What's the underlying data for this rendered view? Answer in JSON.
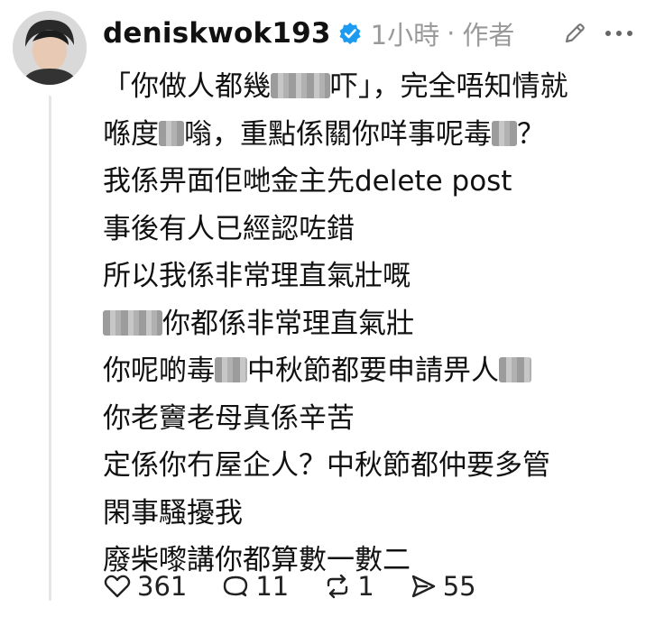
{
  "post": {
    "username": "deniskwok193",
    "time": "1小時",
    "separator": "·",
    "author_tag": "作者",
    "lines": [
      [
        "「你做人都幾",
        "[blur]",
        "吓」，完全唔知情就"
      ],
      [
        "喺度",
        "[blur]",
        "嗡，重點係關你咩事呢毒",
        "[blur]",
        "？"
      ],
      [
        "我係畀面佢哋金主先delete post"
      ],
      [
        "事後有人已經認咗錯"
      ],
      [
        "所以我係非常理直氣壯嘅"
      ],
      [
        "[blur]",
        "你都係非常理直氣壯"
      ],
      [
        "你呢啲毒",
        "[blur]",
        "中秋節都要申請畀人",
        "[blur]"
      ],
      [
        "你老竇老母真係辛苦"
      ],
      [
        "定係你冇屋企人？中秋節都仲要多管"
      ],
      [
        "閑事騷擾我"
      ],
      [
        "廢柴嚟講你都算數一數二"
      ]
    ]
  },
  "actions": {
    "likes": "361",
    "comments": "11",
    "reposts": "1",
    "shares": "55"
  },
  "icons": {
    "verified": "verified-badge-icon",
    "edit": "pencil-icon",
    "more": "more-dots-icon",
    "like": "heart-icon",
    "comment": "comment-bubble-icon",
    "repost": "repost-icon",
    "share": "send-icon"
  },
  "colors": {
    "verified": "#1d9bf0",
    "meta": "#9a9a9a",
    "thread_line": "#e6e6e6"
  }
}
